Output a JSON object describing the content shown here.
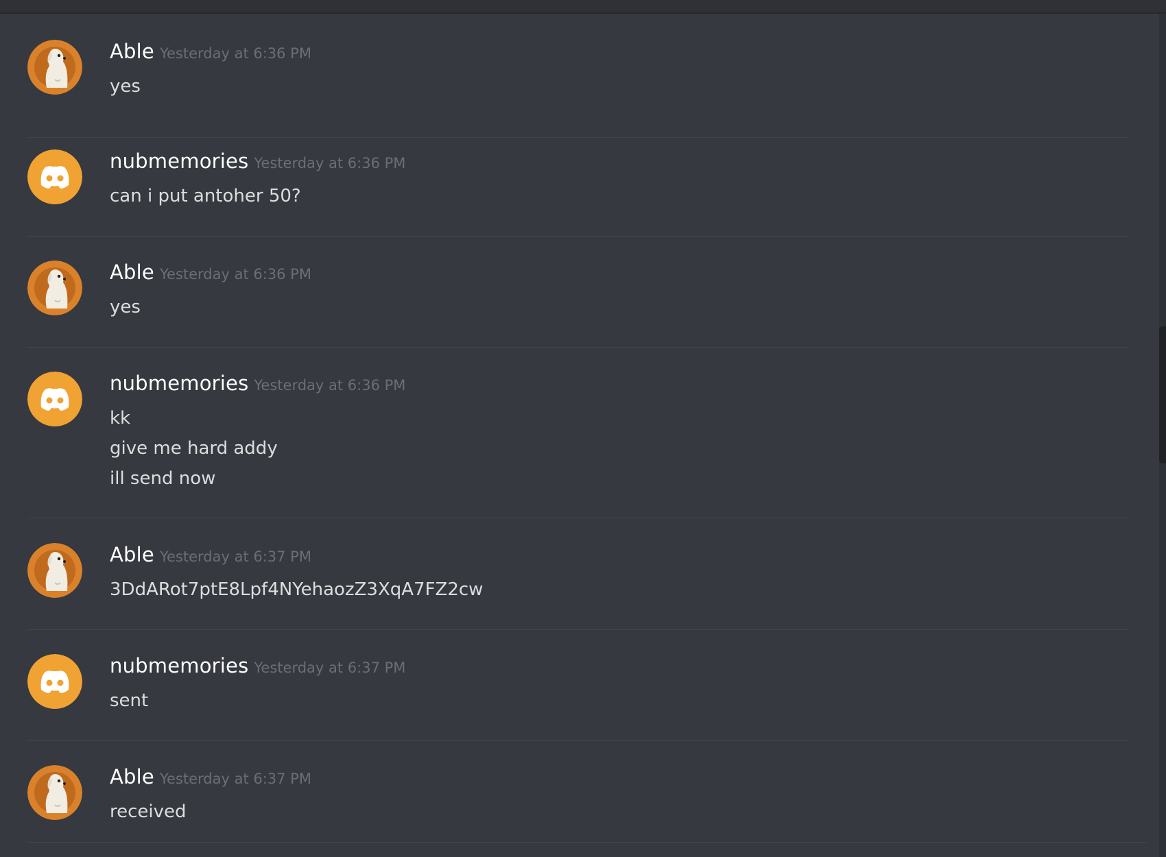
{
  "messages": [
    {
      "author": "Able",
      "timestamp": "Yesterday at 6:36 PM",
      "avatar": "dog-avatar-icon",
      "lines": [
        "yes"
      ]
    },
    {
      "author": "nubmemories",
      "timestamp": "Yesterday at 6:36 PM",
      "avatar": "discord-default-avatar-icon",
      "lines": [
        "can i put antoher 50?"
      ]
    },
    {
      "author": "Able",
      "timestamp": "Yesterday at 6:36 PM",
      "avatar": "dog-avatar-icon",
      "lines": [
        "yes"
      ]
    },
    {
      "author": "nubmemories",
      "timestamp": "Yesterday at 6:36 PM",
      "avatar": "discord-default-avatar-icon",
      "lines": [
        "kk",
        "give me hard addy",
        "ill send now"
      ]
    },
    {
      "author": "Able",
      "timestamp": "Yesterday at 6:37 PM",
      "avatar": "dog-avatar-icon",
      "lines": [
        "3DdARot7ptE8Lpf4NYehaozZ3XqA7FZ2cw"
      ]
    },
    {
      "author": "nubmemories",
      "timestamp": "Yesterday at 6:37 PM",
      "avatar": "discord-default-avatar-icon",
      "lines": [
        "sent"
      ]
    },
    {
      "author": "Able",
      "timestamp": "Yesterday at 6:37 PM",
      "avatar": "dog-avatar-icon",
      "lines": [
        "received"
      ]
    }
  ],
  "colors": {
    "background": "#36393f",
    "discord_avatar": "#f0a232",
    "dog_avatar_bg": "#d9822b"
  }
}
